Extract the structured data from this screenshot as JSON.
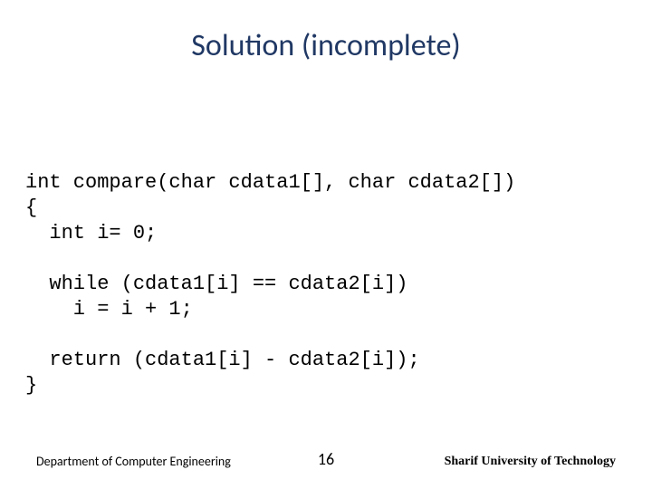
{
  "title": "Solution (incomplete)",
  "code": {
    "line1": "int compare(char cdata1[], char cdata2[])",
    "line2": "{",
    "line3": "  int i= 0;",
    "line4": "",
    "line5": "  while (cdata1[i] == cdata2[i])",
    "line6": "    i = i + 1;",
    "line7": "",
    "line8": "  return (cdata1[i] - cdata2[i]);",
    "line9": "}"
  },
  "footer": {
    "left": "Department of Computer Engineering",
    "center": "16",
    "right": "Sharif University of Technology"
  }
}
